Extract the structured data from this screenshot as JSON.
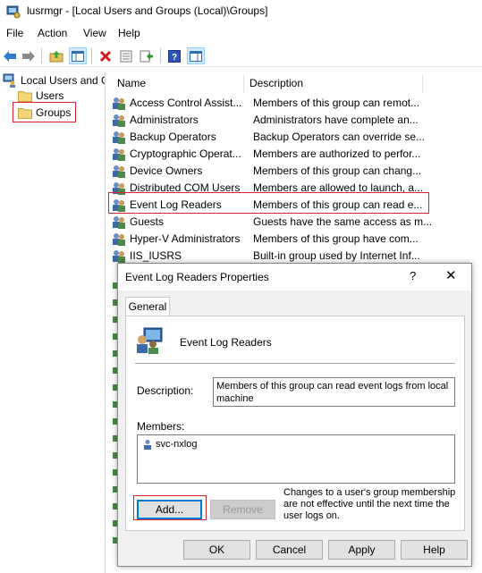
{
  "window": {
    "title": "lusrmgr - [Local Users and Groups (Local)\\Groups]"
  },
  "menu": [
    "File",
    "Action",
    "View",
    "Help"
  ],
  "toolbar": {
    "buttons": [
      "back-arrow-icon",
      "forward-arrow-icon",
      "up-folder-icon",
      "show-tree-icon",
      "delete-icon",
      "properties-icon",
      "export-icon",
      "help-icon",
      "show-pane-icon"
    ]
  },
  "tree": {
    "root": "Local Users and G",
    "items": [
      "Users",
      "Groups"
    ]
  },
  "list": {
    "columns": [
      "Name",
      "Description"
    ],
    "rows": [
      {
        "name": "Access Control Assist...",
        "desc": "Members of this group can remot..."
      },
      {
        "name": "Administrators",
        "desc": "Administrators have complete an..."
      },
      {
        "name": "Backup Operators",
        "desc": "Backup Operators can override se..."
      },
      {
        "name": "Cryptographic Operat...",
        "desc": "Members are authorized to perfor..."
      },
      {
        "name": "Device Owners",
        "desc": "Members of this group can chang..."
      },
      {
        "name": "Distributed COM Users",
        "desc": "Members are allowed to launch, a..."
      },
      {
        "name": "Event Log Readers",
        "desc": "Members of this group can read e..."
      },
      {
        "name": "Guests",
        "desc": "Guests have the same access as m..."
      },
      {
        "name": "Hyper-V Administrators",
        "desc": "Members of this group have com..."
      },
      {
        "name": "IIS_IUSRS",
        "desc": "Built-in group used by Internet Inf..."
      }
    ]
  },
  "dialog": {
    "title": "Event Log Readers Properties",
    "help_glyph": "?",
    "close_glyph": "✕",
    "tab": "General",
    "group_name": "Event Log Readers",
    "description_label": "Description:",
    "description_value": "Members of this group can read event logs from local machine",
    "members_label": "Members:",
    "members": [
      "svc-nxlog"
    ],
    "add_label": "Add...",
    "remove_label": "Remove",
    "note": [
      "Changes to a user's group membership",
      "are not effective until the next time the",
      "user logs on."
    ],
    "ok_label": "OK",
    "cancel_label": "Cancel",
    "apply_label": "Apply",
    "help_label": "Help"
  },
  "colors": {
    "highlight": "#d9232f",
    "accent": "#0078d7"
  }
}
